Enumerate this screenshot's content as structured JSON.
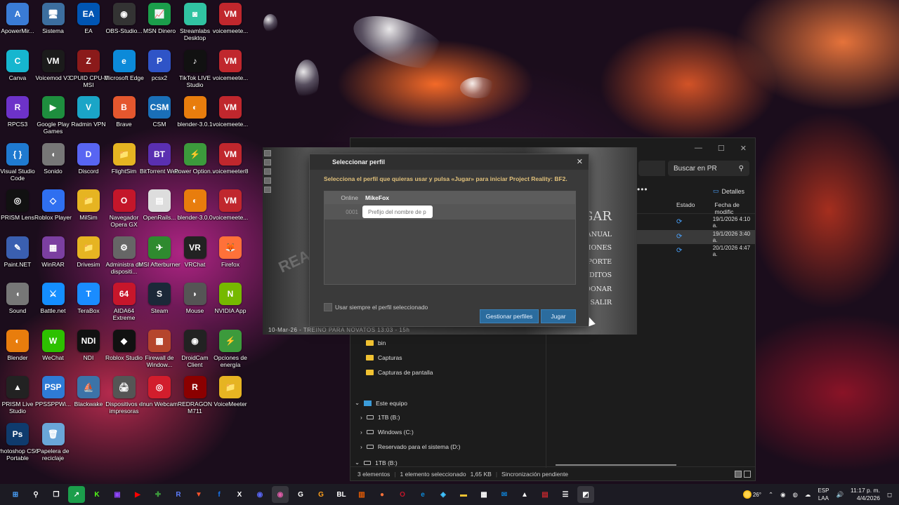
{
  "desktop_icons": [
    {
      "label": "ApowerMir...",
      "glyph": "A",
      "color": "#3a7bd5",
      "icon": "apowermirror-icon"
    },
    {
      "label": "Sistema",
      "glyph": "🖥",
      "color": "#3c6e9f",
      "icon": "system-icon"
    },
    {
      "label": "EA",
      "glyph": "EA",
      "color": "#0055b3",
      "icon": "ea-icon"
    },
    {
      "label": "OBS-Studio...",
      "glyph": "◉",
      "color": "#333",
      "icon": "obs-icon"
    },
    {
      "label": "MSN Dinero",
      "glyph": "📈",
      "color": "#1b9e4b",
      "icon": "msn-money-icon"
    },
    {
      "label": "Streamlabs Desktop",
      "glyph": "◙",
      "color": "#31c3a2",
      "icon": "streamlabs-icon"
    },
    {
      "label": "voicemeete...",
      "glyph": "VM",
      "color": "#c0272d",
      "icon": "voicemeeter-icon"
    },
    {
      "label": "Canva",
      "glyph": "C",
      "color": "#16b6cf",
      "icon": "canva-icon"
    },
    {
      "label": "Voicemod V3",
      "glyph": "VM",
      "color": "#1b1b1b",
      "icon": "voicemod-icon"
    },
    {
      "label": "CPUID CPU-Z MSI",
      "glyph": "Z",
      "color": "#8b1a1a",
      "icon": "cpuz-icon"
    },
    {
      "label": "Microsoft Edge",
      "glyph": "e",
      "color": "#0c8ad9",
      "icon": "edge-icon"
    },
    {
      "label": "pcsx2",
      "glyph": "P",
      "color": "#2f54c7",
      "icon": "pcsx2-icon"
    },
    {
      "label": "TikTok LIVE Studio",
      "glyph": "♪",
      "color": "#111",
      "icon": "tiktok-icon"
    },
    {
      "label": "voicemeete...",
      "glyph": "VM",
      "color": "#c0272d",
      "icon": "voicemeeter-icon"
    },
    {
      "label": "RPCS3",
      "glyph": "R",
      "color": "#6d32c9",
      "icon": "rpcs3-icon"
    },
    {
      "label": "Google Play Games",
      "glyph": "▶",
      "color": "#1e8e3e",
      "icon": "google-play-games-icon"
    },
    {
      "label": "Radmin VPN",
      "glyph": "V",
      "color": "#1aa5c7",
      "icon": "radmin-vpn-icon"
    },
    {
      "label": "Brave",
      "glyph": "B",
      "color": "#e4572e",
      "icon": "brave-icon"
    },
    {
      "label": "CSM",
      "glyph": "CSM",
      "color": "#1a6fb8",
      "icon": "csm-icon"
    },
    {
      "label": "blender-3.0.1",
      "glyph": "◐",
      "color": "#e87d0d",
      "icon": "blender-icon"
    },
    {
      "label": "voicemeete...",
      "glyph": "VM",
      "color": "#c0272d",
      "icon": "voicemeeter-icon"
    },
    {
      "label": "Visual Studio Code",
      "glyph": "{ }",
      "color": "#1f7ad0",
      "icon": "vscode-icon"
    },
    {
      "label": "Sonido",
      "glyph": "◖",
      "color": "#777",
      "icon": "sound-icon"
    },
    {
      "label": "Discord",
      "glyph": "D",
      "color": "#5865f2",
      "icon": "discord-icon"
    },
    {
      "label": "FlightSim",
      "glyph": "📁",
      "color": "#e6b422",
      "icon": "folder-icon"
    },
    {
      "label": "BitTorrent Web",
      "glyph": "BT",
      "color": "#5a2fb1",
      "icon": "bittorrent-icon"
    },
    {
      "label": "Power Option...",
      "glyph": "⚡",
      "color": "#3c9a3c",
      "icon": "power-options-icon"
    },
    {
      "label": "voicemeeter8",
      "glyph": "VM",
      "color": "#c0272d",
      "icon": "voicemeeter-icon"
    },
    {
      "label": "PRISM Lens",
      "glyph": "◎",
      "color": "#111",
      "icon": "prism-lens-icon"
    },
    {
      "label": "Roblox Player",
      "glyph": "◇",
      "color": "#2f6ff0",
      "icon": "roblox-icon"
    },
    {
      "label": "MilSim",
      "glyph": "📁",
      "color": "#e6b422",
      "icon": "folder-icon"
    },
    {
      "label": "Navegador Opera GX",
      "glyph": "O",
      "color": "#c4162a",
      "icon": "opera-gx-icon"
    },
    {
      "label": "OpenRails...",
      "glyph": "▤",
      "color": "#ddd",
      "icon": "document-icon"
    },
    {
      "label": "blender-3.0.0",
      "glyph": "◐",
      "color": "#e87d0d",
      "icon": "blender-icon"
    },
    {
      "label": "voicemeete...",
      "glyph": "VM",
      "color": "#c0272d",
      "icon": "voicemeeter-icon"
    },
    {
      "label": "Paint.NET",
      "glyph": "✎",
      "color": "#3a5fb0",
      "icon": "paintnet-icon"
    },
    {
      "label": "WinRAR",
      "glyph": "▦",
      "color": "#7b3fa0",
      "icon": "winrar-icon"
    },
    {
      "label": "Drivesim",
      "glyph": "📁",
      "color": "#e6b422",
      "icon": "folder-icon"
    },
    {
      "label": "Administra de dispositi...",
      "glyph": "⚙",
      "color": "#666",
      "icon": "device-manager-icon"
    },
    {
      "label": "MSI Afterburner",
      "glyph": "✈",
      "color": "#2f8a2f",
      "icon": "afterburner-icon"
    },
    {
      "label": "VRChat",
      "glyph": "VR",
      "color": "#222",
      "icon": "vrchat-icon"
    },
    {
      "label": "Firefox",
      "glyph": "🦊",
      "color": "#ff7139",
      "icon": "firefox-icon"
    },
    {
      "label": "Sound",
      "glyph": "◖",
      "color": "#777",
      "icon": "sound-icon"
    },
    {
      "label": "Battle.net",
      "glyph": "⚔",
      "color": "#148eff",
      "icon": "battlenet-icon"
    },
    {
      "label": "TeraBox",
      "glyph": "T",
      "color": "#1a8cff",
      "icon": "terabox-icon"
    },
    {
      "label": "AIDA64 Extreme",
      "glyph": "64",
      "color": "#c7162b",
      "icon": "aida64-icon"
    },
    {
      "label": "Steam",
      "glyph": "S",
      "color": "#1b2838",
      "icon": "steam-icon"
    },
    {
      "label": "Mouse",
      "glyph": "◗",
      "color": "#555",
      "icon": "mouse-icon"
    },
    {
      "label": "NVIDIA App",
      "glyph": "N",
      "color": "#76b900",
      "icon": "nvidia-icon"
    },
    {
      "label": "Blender",
      "glyph": "◐",
      "color": "#e87d0d",
      "icon": "blender-icon"
    },
    {
      "label": "WeChat",
      "glyph": "W",
      "color": "#2dc100",
      "icon": "wechat-icon"
    },
    {
      "label": "NDI",
      "glyph": "NDI",
      "color": "#111",
      "icon": "ndi-icon"
    },
    {
      "label": "Roblox Studio",
      "glyph": "◆",
      "color": "#111",
      "icon": "roblox-studio-icon"
    },
    {
      "label": "Firewall de Window...",
      "glyph": "▩",
      "color": "#b5452d",
      "icon": "firewall-icon"
    },
    {
      "label": "DroidCam Client",
      "glyph": "◉",
      "color": "#222",
      "icon": "droidcam-icon"
    },
    {
      "label": "Opciones de energía",
      "glyph": "⚡",
      "color": "#3c9a3c",
      "icon": "power-options-icon"
    },
    {
      "label": "PRISM Live Studio",
      "glyph": "▲",
      "color": "#222",
      "icon": "prism-live-icon"
    },
    {
      "label": "PPSSPPWi...",
      "glyph": "PSP",
      "color": "#2e7bd6",
      "icon": "ppsspp-icon"
    },
    {
      "label": "Blackwake",
      "glyph": "⛵",
      "color": "#3c73a8",
      "icon": "blackwake-icon"
    },
    {
      "label": "Dispositivos e impresoras",
      "glyph": "🖨",
      "color": "#555",
      "icon": "printer-icon"
    },
    {
      "label": "Inun Webcam",
      "glyph": "◎",
      "color": "#d21d2c",
      "icon": "webcam-icon"
    },
    {
      "label": "REDRAGON M711",
      "glyph": "R",
      "color": "#8b0000",
      "icon": "redragon-icon"
    },
    {
      "label": "VoiceMeeter",
      "glyph": "📁",
      "color": "#e6b422",
      "icon": "folder-icon"
    },
    {
      "label": "Photoshop CS6 Portable",
      "glyph": "Ps",
      "color": "#0f3b6d",
      "icon": "photoshop-icon"
    },
    {
      "label": "Papelera de reciclaje",
      "glyph": "🗑",
      "color": "#6aa6d8",
      "icon": "recycle-bin-icon"
    }
  ],
  "explorer": {
    "search_label": "Buscar en PR",
    "details_label": "Detalles",
    "columns": [
      "Estado",
      "Fecha de modific"
    ],
    "rows": [
      {
        "date": "19/1/2026 4:10 a."
      },
      {
        "date": "19/1/2026 3:40 a."
      },
      {
        "date": "20/1/2026 4:47 a."
      }
    ],
    "nav": {
      "bin": "bin",
      "capturas": "Capturas",
      "capturas_pantalla": "Capturas de pantalla",
      "este_equipo": "Este equipo",
      "d1": "1TB (B:)",
      "d2": "Windows (C:)",
      "d3": "Reservado para el sistema (D:)",
      "d4": "1TB (B:)"
    },
    "status": {
      "count": "3 elementos",
      "selected": "1 elemento seleccionado",
      "size": "1,65 KB",
      "sync": "Sincronización pendiente"
    }
  },
  "launcher": {
    "logo": "PR",
    "status_line": "10-Mar-26 - TREINO PARA NOVATOS 13:03 - 15h",
    "menu": {
      "jugar": "JUGAR",
      "manual": "MANUAL",
      "opciones": "OPCIONES",
      "soporte": "SOPORTE",
      "creditos": "CRÉDITOS",
      "donar": "DONAR",
      "salir": "SALIR"
    }
  },
  "dialog": {
    "title": "Seleccionar perfil",
    "instructions": "Selecciona el perfil que quieras usar y pulsa «Jugar» para iniciar Project Reality: BF2.",
    "profile_header_status": "Online",
    "profile_header_name": "MikeFox",
    "new_profile_id": "0001",
    "new_profile_placeholder": "Prefijo del nombre de p",
    "always_use_label": "Usar siempre el perfil seleccionado",
    "manage_button": "Gestionar perfiles",
    "play_button": "Jugar"
  },
  "taskbar": {
    "weather_temp": "26°",
    "lang_top": "ESP",
    "lang_bottom": "LAA",
    "time": "11:17 p. m.",
    "date": "4/4/2026"
  }
}
